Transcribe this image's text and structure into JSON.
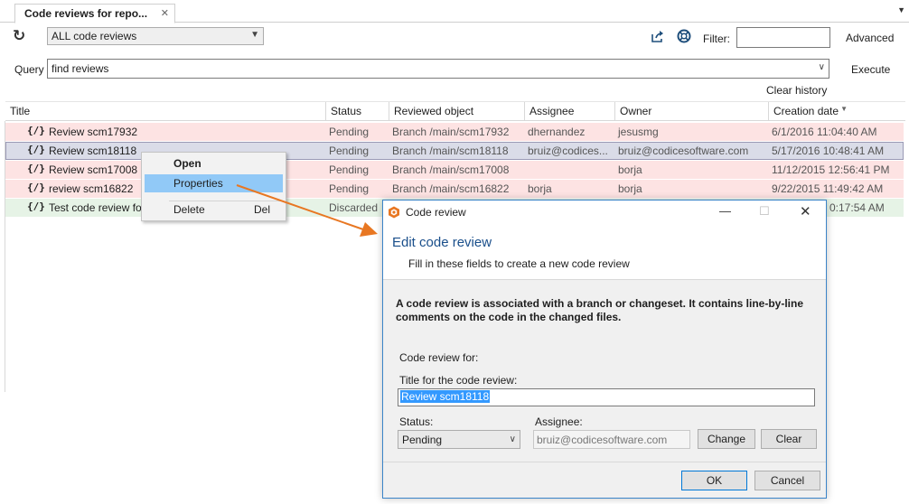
{
  "tab": {
    "title": "Code reviews for repo...",
    "close_glyph": "✕",
    "menu_glyph": "▼"
  },
  "toolbar": {
    "refresh_glyph": "↻",
    "filter_combo": "ALL code reviews",
    "filter_label": "Filter:",
    "filter_value": "",
    "advanced_label": "Advanced"
  },
  "query": {
    "label": "Query",
    "value": "find reviews",
    "execute_label": "Execute",
    "clear_history_label": "Clear history"
  },
  "grid": {
    "columns": [
      "Title",
      "Status",
      "Reviewed object",
      "Assignee",
      "Owner",
      "Creation date"
    ],
    "rows": [
      {
        "icon": "{/}",
        "title": "Review scm17932",
        "status": "Pending",
        "object": "Branch /main/scm17932",
        "assignee": "dhernandez",
        "owner": "jesusmg",
        "date": "6/1/2016 11:04:40 AM",
        "state": "pending"
      },
      {
        "icon": "{/}",
        "title": "Review scm18118",
        "status": "Pending",
        "object": "Branch /main/scm18118",
        "assignee": "bruiz@codices...",
        "owner": "bruiz@codicesoftware.com",
        "date": "5/17/2016 10:48:41 AM",
        "state": "selected"
      },
      {
        "icon": "{/}",
        "title": "Review scm17008",
        "status": "Pending",
        "object": "Branch /main/scm17008",
        "assignee": "",
        "owner": "borja",
        "date": "11/12/2015 12:56:41 PM",
        "state": "pending"
      },
      {
        "icon": "{/}",
        "title": "review scm16822",
        "status": "Pending",
        "object": "Branch /main/scm16822",
        "assignee": "borja",
        "owner": "borja",
        "date": "9/22/2015 11:49:42 AM",
        "state": "pending"
      },
      {
        "icon": "{/}",
        "title": "Test code review fo",
        "status": "Discarded",
        "object": "",
        "assignee": "",
        "owner": "",
        "date": "0:17:54 AM",
        "state": "discarded"
      }
    ]
  },
  "context_menu": {
    "open": "Open",
    "properties": "Properties",
    "delete": "Delete",
    "delete_shortcut": "Del"
  },
  "dialog": {
    "window_title": "Code review",
    "heading": "Edit code review",
    "subheading": "Fill in these fields to create a new code review",
    "description": "A code review is associated with a branch or changeset. It contains line-by-line comments on the code in the changed files.",
    "review_for_label": "Code review for:",
    "title_label": "Title for the code review:",
    "title_value": "Review scm18118",
    "status_label": "Status:",
    "status_value": "Pending",
    "assignee_label": "Assignee:",
    "assignee_value": "bruiz@codicesoftware.com",
    "change_button": "Change",
    "clear_button": "Clear",
    "ok_button": "OK",
    "cancel_button": "Cancel",
    "minimize_glyph": "—",
    "maximize_glyph": "☐",
    "close_glyph": "✕"
  },
  "colors": {
    "pending_row": "#fde3e3",
    "selected_row": "#dadce8",
    "discarded_row": "#e6f3e6",
    "menu_highlight": "#91c9f7",
    "callout_arrow": "#e87722",
    "accent": "#1a4f8b"
  },
  "icons": {
    "refresh": "refresh-icon",
    "share": "share-icon",
    "help": "help-lifebuoy-icon",
    "code_review": "code-review-icon",
    "dialog_logo": "plastic-logo-icon"
  }
}
